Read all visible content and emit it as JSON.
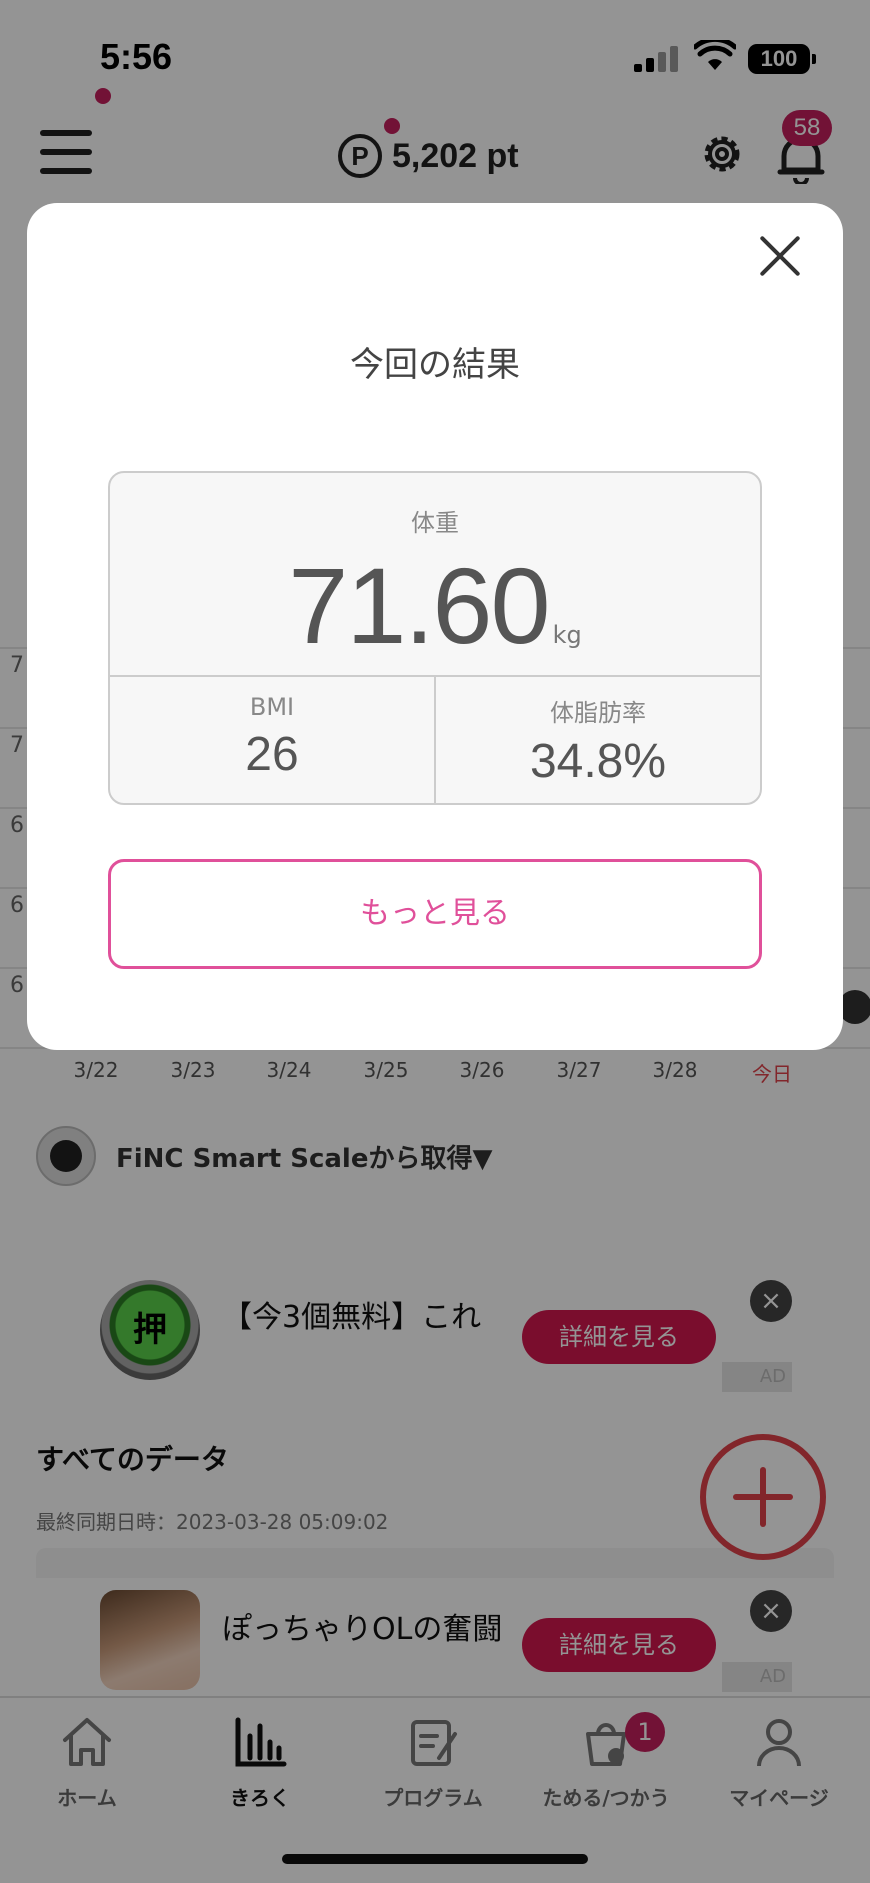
{
  "status_bar": {
    "time": "5:56",
    "battery": "100"
  },
  "header": {
    "points": "5,202 pt",
    "points_icon": "P",
    "notification_count": "58"
  },
  "chart": {
    "y_ticks": [
      "7",
      "7",
      "6",
      "6",
      "6"
    ],
    "x_ticks": [
      "3/22",
      "3/23",
      "3/24",
      "3/25",
      "3/26",
      "3/27",
      "3/28",
      "今日"
    ]
  },
  "source": {
    "text": "FiNC Smart Scaleから取得▼"
  },
  "ads": [
    {
      "title": "【今3個無料】これ",
      "cta": "詳細を見る",
      "label": "AD"
    },
    {
      "title": "ぽっちゃりOLの奮闘",
      "cta": "詳細を見る",
      "label": "AD"
    }
  ],
  "all_data": {
    "title": "すべてのデータ",
    "sync": "最終同期日時：2023-03-28 05:09:02"
  },
  "tabbar": {
    "items": [
      {
        "label": "ホーム"
      },
      {
        "label": "きろく"
      },
      {
        "label": "プログラム"
      },
      {
        "label": "ためる/つかう",
        "badge": "1"
      },
      {
        "label": "マイページ"
      }
    ]
  },
  "modal": {
    "title": "今回の結果",
    "weight_label": "体重",
    "weight_value": "71.60",
    "weight_unit": "kg",
    "bmi_label": "BMI",
    "bmi_value": "26",
    "fat_label": "体脂肪率",
    "fat_value": "34.8%",
    "more_button": "もっと見る"
  },
  "colors": {
    "accent": "#c51f5d",
    "button_border": "#e0509a",
    "fab": "#e0434a"
  }
}
